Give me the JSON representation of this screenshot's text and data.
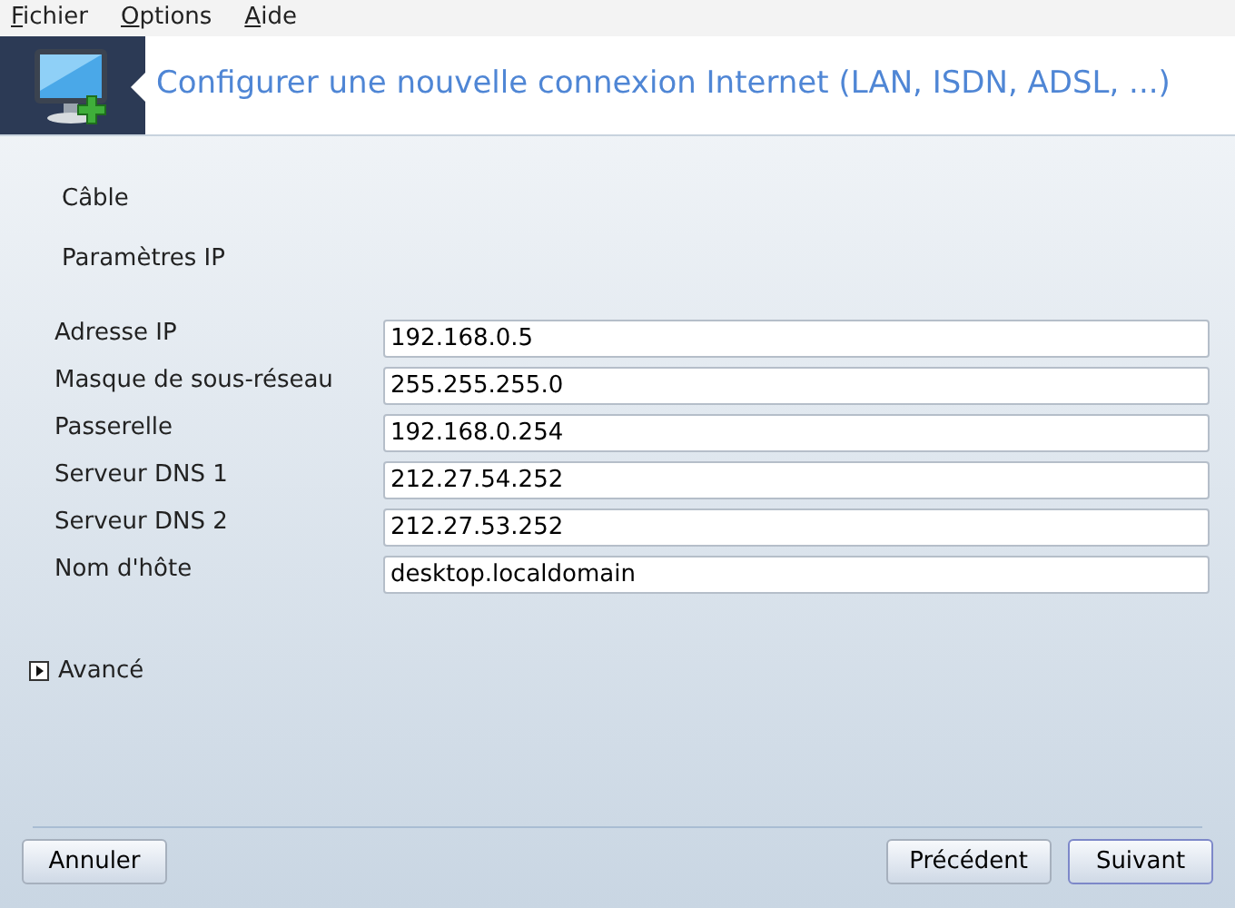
{
  "menu": [
    {
      "label": "Fichier"
    },
    {
      "label": "Options"
    },
    {
      "label": "Aide"
    }
  ],
  "header": {
    "title": "Configurer une nouvelle connexion Internet (LAN, ISDN, ADSL, ...)"
  },
  "sections": [
    "Câble",
    "Paramètres IP"
  ],
  "fields": [
    {
      "label": "Adresse IP",
      "value": "192.168.0.5"
    },
    {
      "label": "Masque de sous-réseau",
      "value": "255.255.255.0"
    },
    {
      "label": "Passerelle",
      "value": "192.168.0.254"
    },
    {
      "label": "Serveur DNS 1",
      "value": "212.27.54.252"
    },
    {
      "label": "Serveur DNS 2",
      "value": "212.27.53.252"
    },
    {
      "label": "Nom d'hôte",
      "value": "desktop.localdomain"
    }
  ],
  "advanced": {
    "label": "Avancé",
    "expanded": false
  },
  "buttons": [
    {
      "label": "Annuler",
      "kind": "cancel",
      "selected": false
    },
    {
      "label": "Précédent",
      "kind": "nav",
      "selected": false
    },
    {
      "label": "Suivant",
      "kind": "nav",
      "selected": true
    }
  ]
}
